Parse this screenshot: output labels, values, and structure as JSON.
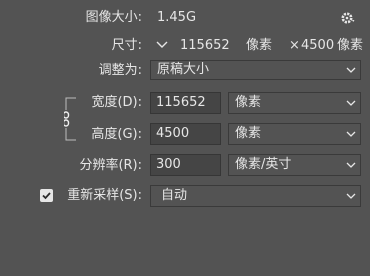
{
  "image_size": {
    "label": "图像大小:",
    "value": "1.45G",
    "settings_icon": "gear-icon"
  },
  "dimensions": {
    "label": "尺寸:",
    "width": "115652",
    "unit_w": "像素",
    "times": "×",
    "height": "4500",
    "unit_h": "像素"
  },
  "fit_to": {
    "label": "调整为:",
    "selected": "原稿大小"
  },
  "width_field": {
    "label": "宽度(D):",
    "value": "115652",
    "unit": "像素"
  },
  "height_field": {
    "label": "高度(G):",
    "value": "4500",
    "unit": "像素"
  },
  "resolution": {
    "label": "分辨率(R):",
    "value": "300",
    "unit": "像素/英寸"
  },
  "resample": {
    "label": "重新采样(S):",
    "checked": true,
    "selected": "自动"
  }
}
